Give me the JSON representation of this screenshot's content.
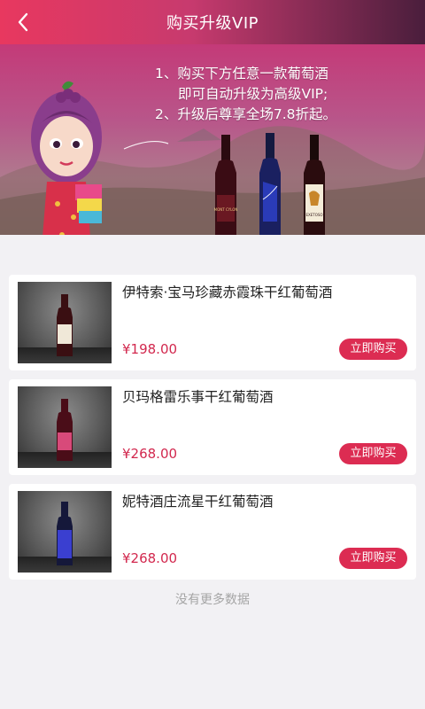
{
  "header": {
    "title": "购买升级VIP",
    "back_icon": "chevron-left-icon"
  },
  "banner": {
    "line1": "1、购买下方任意一款葡萄酒",
    "line2": "即可自动升级为高级VIP;",
    "line3": "2、升级后尊享全场7.8折起。",
    "bottle_labels": [
      "MONT CYLON",
      "",
      "EXETOSO"
    ]
  },
  "products": [
    {
      "name": "伊特索·宝马珍藏赤霞珠干红葡萄酒",
      "price": "¥198.00",
      "buy_label": "立即购买",
      "bottle_color": "#3a0f12",
      "label_color": "#f0e8d8"
    },
    {
      "name": "贝玛格雷乐事干红葡萄酒",
      "price": "¥268.00",
      "buy_label": "立即购买",
      "bottle_color": "#4a0d18",
      "label_color": "#d84a7a"
    },
    {
      "name": "妮特酒庄流星干红葡萄酒",
      "price": "¥268.00",
      "buy_label": "立即购买",
      "bottle_color": "#15183a",
      "label_color": "#3a3fd0"
    }
  ],
  "footer": {
    "no_more": "没有更多数据"
  },
  "colors": {
    "accent": "#dc2c52",
    "price": "#d2284e"
  }
}
